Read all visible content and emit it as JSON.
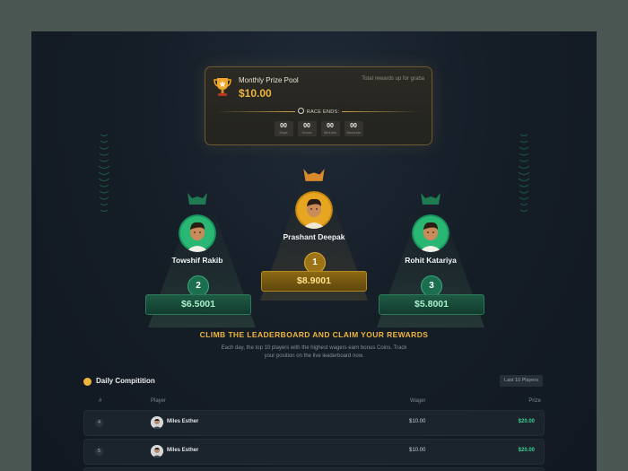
{
  "pool": {
    "title": "Monthly Prize Pool",
    "amount": "$10.00",
    "subtitle": "Total rewards up for graba",
    "race_label": "RACE ENDS:",
    "timer": [
      {
        "value": "00",
        "unit": "Days"
      },
      {
        "value": "00",
        "unit": "Hours"
      },
      {
        "value": "00",
        "unit": "Minutes"
      },
      {
        "value": "00",
        "unit": "Seconds"
      }
    ]
  },
  "podium": {
    "first": {
      "name": "Prashant Deepak",
      "rank": "1",
      "prize": "$8.9001"
    },
    "second": {
      "name": "Towshif Rakib",
      "rank": "2",
      "prize": "$6.5001"
    },
    "third": {
      "name": "Rohit Katariya",
      "rank": "3",
      "prize": "$5.8001"
    }
  },
  "claim": {
    "title": "CLIMB THE LEADERBOARD AND CLAIM YOUR REWARDS",
    "description": "Each day, the top 10 players with the highest wagers earn bonus Coins. Track your position on the live leaderboard now."
  },
  "leaderboard": {
    "title": "Daily Compitition",
    "filter": "Last 10 Players",
    "columns": {
      "rank": "#",
      "player": "Player",
      "wager": "Wager",
      "prize": "Prize"
    },
    "rows": [
      {
        "rank": "4",
        "player": "Miles Esther",
        "wager": "$10.00",
        "prize": "$20.00"
      },
      {
        "rank": "5",
        "player": "Miles Esther",
        "wager": "$10.00",
        "prize": "$20.00"
      }
    ]
  },
  "colors": {
    "gold": "#f0b53c",
    "green": "#3ccf8e",
    "background": "#151d27"
  }
}
